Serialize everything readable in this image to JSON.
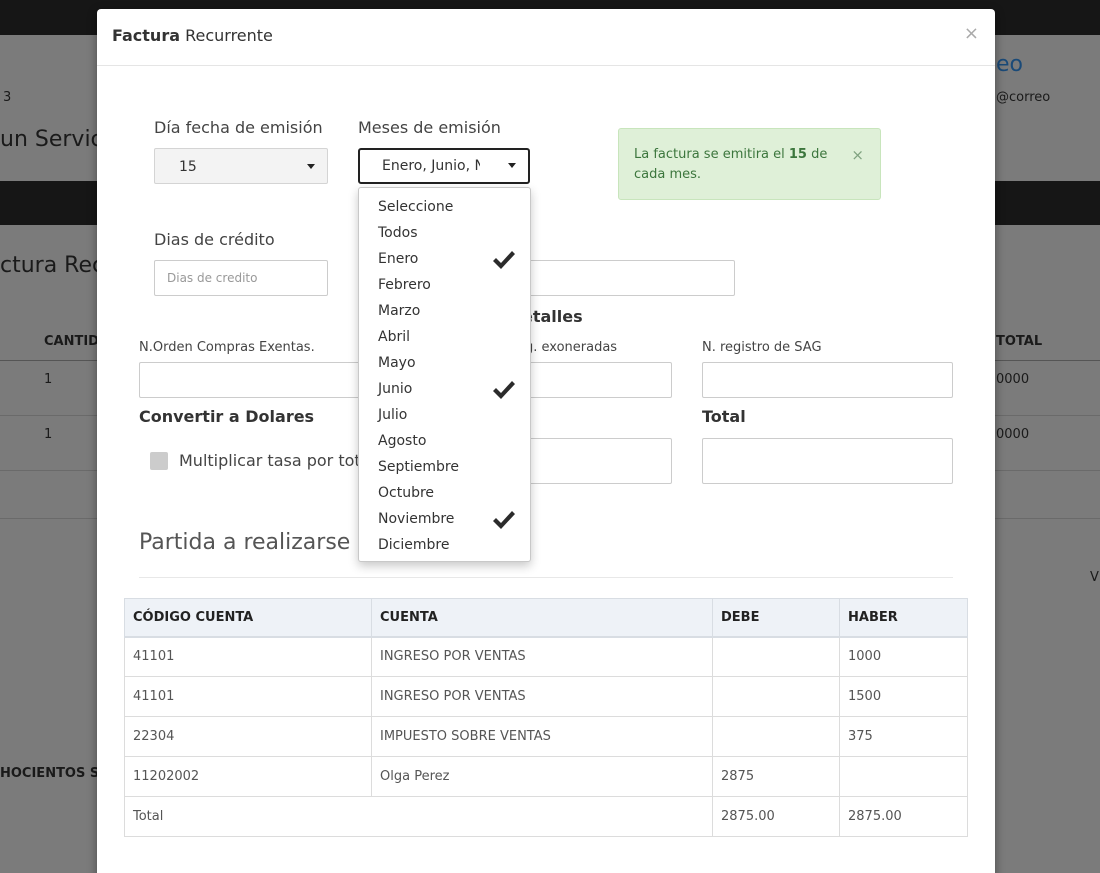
{
  "background": {
    "fragment_3": "3",
    "fragment_service": "un Servic",
    "fragment_eo": "eo",
    "fragment_correo": "@correo",
    "fragment_factura": "ctura Rec",
    "col_cantid": "CANTID",
    "col_total": "TOTAL",
    "row1_qty": "1",
    "row1_total": "0000",
    "row2_qty": "1",
    "row2_total": "0000",
    "fragment_hocientos": "HOCIENTOS SE",
    "fragment_v": "V"
  },
  "modal": {
    "title_bold": "Factura",
    "title_rest": " Recurrente",
    "close": "×",
    "dia_label": "Día fecha de emisión",
    "dia_value": "15",
    "meses_label": "Meses de emisión",
    "meses_value": "Enero, Junio, N",
    "alert": {
      "prefix": "La factura se emitira el ",
      "day": "15",
      "suffix": " de cada mes.",
      "close": "×"
    },
    "dias_credito_label": "Dias de crédito",
    "dias_credito_placeholder": "Dias de credito",
    "detalles_fragment": "etalles",
    "orden_label": "N.Orden Compras Exentas.",
    "exoneradas_fragment": "g. exoneradas",
    "sag_label": "N. registro de SAG",
    "convertir_label": "Convertir a Dolares",
    "total_label": "Total",
    "multiplicar_label": "Multiplicar tasa por total",
    "partida_title": "Partida a realizarse",
    "table": {
      "headers": [
        "CÓDIGO CUENTA",
        "CUENTA",
        "DEBE",
        "HABER"
      ],
      "rows": [
        [
          "41101",
          "INGRESO POR VENTAS",
          "",
          "1000"
        ],
        [
          "41101",
          "INGRESO POR VENTAS",
          "",
          "1500"
        ],
        [
          "22304",
          "IMPUESTO SOBRE VENTAS",
          "",
          "375"
        ],
        [
          "11202002",
          "Olga Perez",
          "2875",
          ""
        ]
      ],
      "total_label": "Total",
      "total_debe": "2875.00",
      "total_haber": "2875.00"
    }
  },
  "dropdown": {
    "items": [
      {
        "label": "Seleccione",
        "checked": false
      },
      {
        "label": "Todos",
        "checked": false
      },
      {
        "label": "Enero",
        "checked": true
      },
      {
        "label": "Febrero",
        "checked": false
      },
      {
        "label": "Marzo",
        "checked": false
      },
      {
        "label": "Abril",
        "checked": false
      },
      {
        "label": "Mayo",
        "checked": false
      },
      {
        "label": "Junio",
        "checked": true
      },
      {
        "label": "Julio",
        "checked": false
      },
      {
        "label": "Agosto",
        "checked": false
      },
      {
        "label": "Septiembre",
        "checked": false
      },
      {
        "label": "Octubre",
        "checked": false
      },
      {
        "label": "Noviembre",
        "checked": true
      },
      {
        "label": "Diciembre",
        "checked": false
      }
    ]
  }
}
